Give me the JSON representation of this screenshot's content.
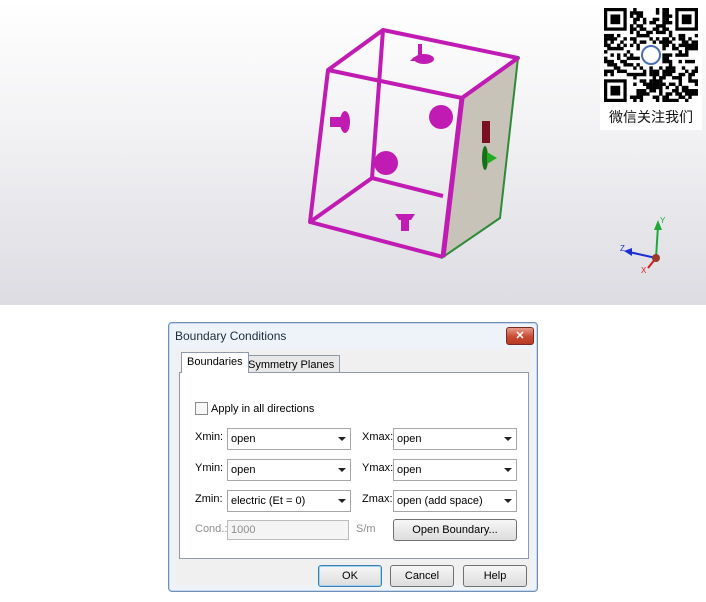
{
  "qr": {
    "caption": "微信关注我们"
  },
  "axes": {
    "y": "Y",
    "z": "Z",
    "x": "X"
  },
  "dialog": {
    "title": "Boundary Conditions",
    "close_label": "✕",
    "tabs": [
      {
        "label": "Boundaries"
      },
      {
        "label": "Symmetry Planes"
      }
    ],
    "apply_all": {
      "label": "Apply in all directions",
      "checked": false
    },
    "fields": {
      "xmin": {
        "label": "Xmin:",
        "value": "open"
      },
      "xmax": {
        "label": "Xmax:",
        "value": "open"
      },
      "ymin": {
        "label": "Ymin:",
        "value": "open"
      },
      "ymax": {
        "label": "Ymax:",
        "value": "open"
      },
      "zmin": {
        "label": "Zmin:",
        "value": "electric (Et = 0)"
      },
      "zmax": {
        "label": "Zmax:",
        "value": "open (add space)"
      }
    },
    "cond": {
      "label": "Cond.:",
      "value": "1000",
      "unit": "S/m"
    },
    "open_boundary_label": "Open Boundary...",
    "ok_label": "OK",
    "cancel_label": "Cancel",
    "help_label": "Help"
  },
  "colors": {
    "frame": "#c01cb4",
    "dialog_border": "#6d8fb8"
  }
}
